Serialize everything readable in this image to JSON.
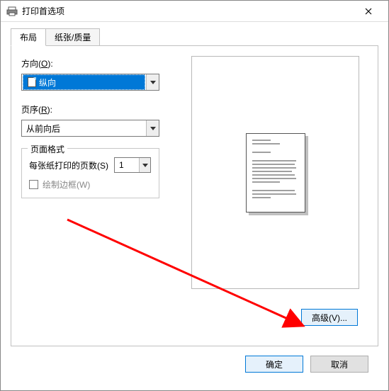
{
  "window": {
    "title": "打印首选项"
  },
  "tabs": {
    "layout": "布局",
    "paper": "纸张/质量"
  },
  "orientation": {
    "label_pre": "方向(",
    "label_ul": "O",
    "label_post": "):",
    "value": "纵向"
  },
  "pageorder": {
    "label_pre": "页序(",
    "label_ul": "R",
    "label_post": "):",
    "value": "从前向后"
  },
  "pageformat": {
    "legend": "页面格式",
    "pps_label_pre": "每张纸打印的页数(",
    "pps_label_ul": "S",
    "pps_label_post": ")",
    "pps_value": "1",
    "border_label_pre": "绘制边框(",
    "border_label_ul": "W",
    "border_label_post": ")"
  },
  "buttons": {
    "advanced_pre": "高级(",
    "advanced_ul": "V",
    "advanced_post": ")...",
    "ok": "确定",
    "cancel": "取消"
  }
}
